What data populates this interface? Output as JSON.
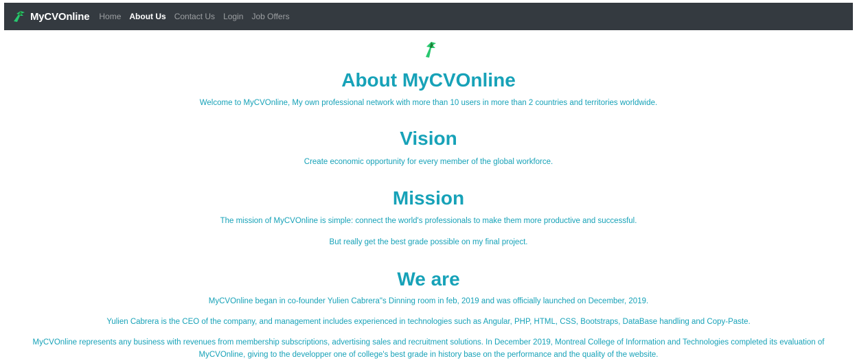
{
  "nav": {
    "brand": "MyCVOnline",
    "links": [
      {
        "label": "Home",
        "active": false
      },
      {
        "label": "About Us",
        "active": true
      },
      {
        "label": "Contact Us",
        "active": false
      },
      {
        "label": "Login",
        "active": false
      },
      {
        "label": "Job Offers",
        "active": false
      }
    ]
  },
  "about": {
    "title": "About MyCVOnline",
    "text": "Welcome to MyCVOnline, My own professional network with more than 10 users in more than 2 countries and territories worldwide."
  },
  "vision": {
    "title": "Vision",
    "text": "Create economic opportunity for every member of the global workforce."
  },
  "mission": {
    "title": "Mission",
    "text1": "The mission of MyCVOnline is simple: connect the world's professionals to make them more productive and successful.",
    "text2": "But really get the best grade possible on my final project."
  },
  "weare": {
    "title": "We are",
    "text1": "MyCVOnline began in co-founder Yulien Cabrera\"s Dinning room in feb, 2019 and was officially launched on December, 2019.",
    "text2": "Yulien Cabrera is the CEO of the company, and management includes experienced in technologies such as Angular, PHP, HTML, CSS, Bootstraps, DataBase handling and Copy-Paste.",
    "text3_line1": "MyCVOnline represents any business with revenues from membership subscriptions, advertising sales and recruitment solutions. In December 2019, Montreal College of Information and Technologies completed its evaluation of",
    "text3_line2": "MyCVOnline, giving to the developper one of college's best grade in history base on the performance and the quality of the website."
  },
  "colors": {
    "accent": "#17a2b8",
    "navbar": "#343a40",
    "logo_dark": "#1e7e34",
    "logo_light": "#28c76f"
  },
  "icons": {
    "brand_logo": "leaf-dragon-logo-icon"
  }
}
